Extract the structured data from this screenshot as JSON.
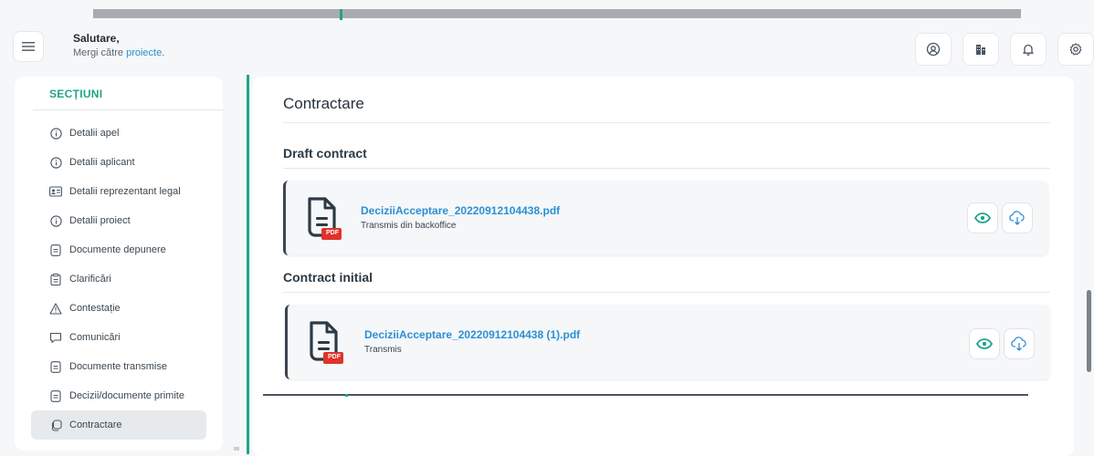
{
  "header": {
    "greeting": "Salutare,",
    "subtitle_prefix": "Mergi către",
    "subtitle_link": "proiecte",
    "subtitle_suffix": "."
  },
  "sidebar": {
    "title": "SECȚIUNI",
    "items": [
      {
        "label": "Detalii apel",
        "icon": "info-icon",
        "active": false
      },
      {
        "label": "Detalii aplicant",
        "icon": "info-icon",
        "active": false
      },
      {
        "label": "Detalii reprezentant legal",
        "icon": "id-card-icon",
        "active": false
      },
      {
        "label": "Detalii proiect",
        "icon": "info-icon",
        "active": false
      },
      {
        "label": "Documente depunere",
        "icon": "document-icon",
        "active": false
      },
      {
        "label": "Clarificări",
        "icon": "clipboard-icon",
        "active": false
      },
      {
        "label": "Contestație",
        "icon": "warning-icon",
        "active": false
      },
      {
        "label": "Comunicări",
        "icon": "chat-icon",
        "active": false
      },
      {
        "label": "Documente transmise",
        "icon": "document-icon",
        "active": false
      },
      {
        "label": "Decizii/documente primite",
        "icon": "document-icon",
        "active": false
      },
      {
        "label": "Contractare",
        "icon": "copy-icon",
        "active": true
      }
    ]
  },
  "main": {
    "title": "Contractare",
    "sections": [
      {
        "title": "Draft contract",
        "file_name": "DeciziiAcceptare_20220912104438.pdf",
        "note": "Transmis din backoffice",
        "badge": "PDF"
      },
      {
        "title": "Contract initial",
        "file_name": "DeciziiAcceptare_20220912104438 (1).pdf",
        "note": "Transmis",
        "badge": "PDF"
      }
    ]
  },
  "colors": {
    "accent": "#20a489",
    "link": "#2c8fd4",
    "pdf_badge": "#e0322b"
  }
}
